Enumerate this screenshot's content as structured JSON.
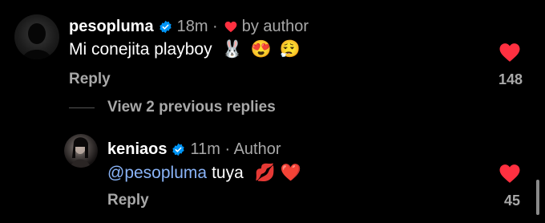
{
  "comments": [
    {
      "username": "pesopluma",
      "time": "18m ·",
      "badge": "by author",
      "text": "Mi conejita playboy",
      "emojis": [
        "🐰",
        "😍",
        "😮‍💨"
      ],
      "reply_label": "Reply",
      "likes": "148"
    },
    {
      "username": "keniaos",
      "time": "11m · Author",
      "mention": "@pesopluma",
      "text": "tuya",
      "emojis": [
        "💋",
        "❤️"
      ],
      "reply_label": "Reply",
      "likes": "45"
    }
  ],
  "thread": {
    "view_replies": "View 2 previous replies"
  },
  "colors": {
    "background": "#000000",
    "like_red": "#ff3040",
    "verified_blue": "#0095f6",
    "mention_blue": "#8ab4f8",
    "secondary_text": "#a8a8a8"
  }
}
